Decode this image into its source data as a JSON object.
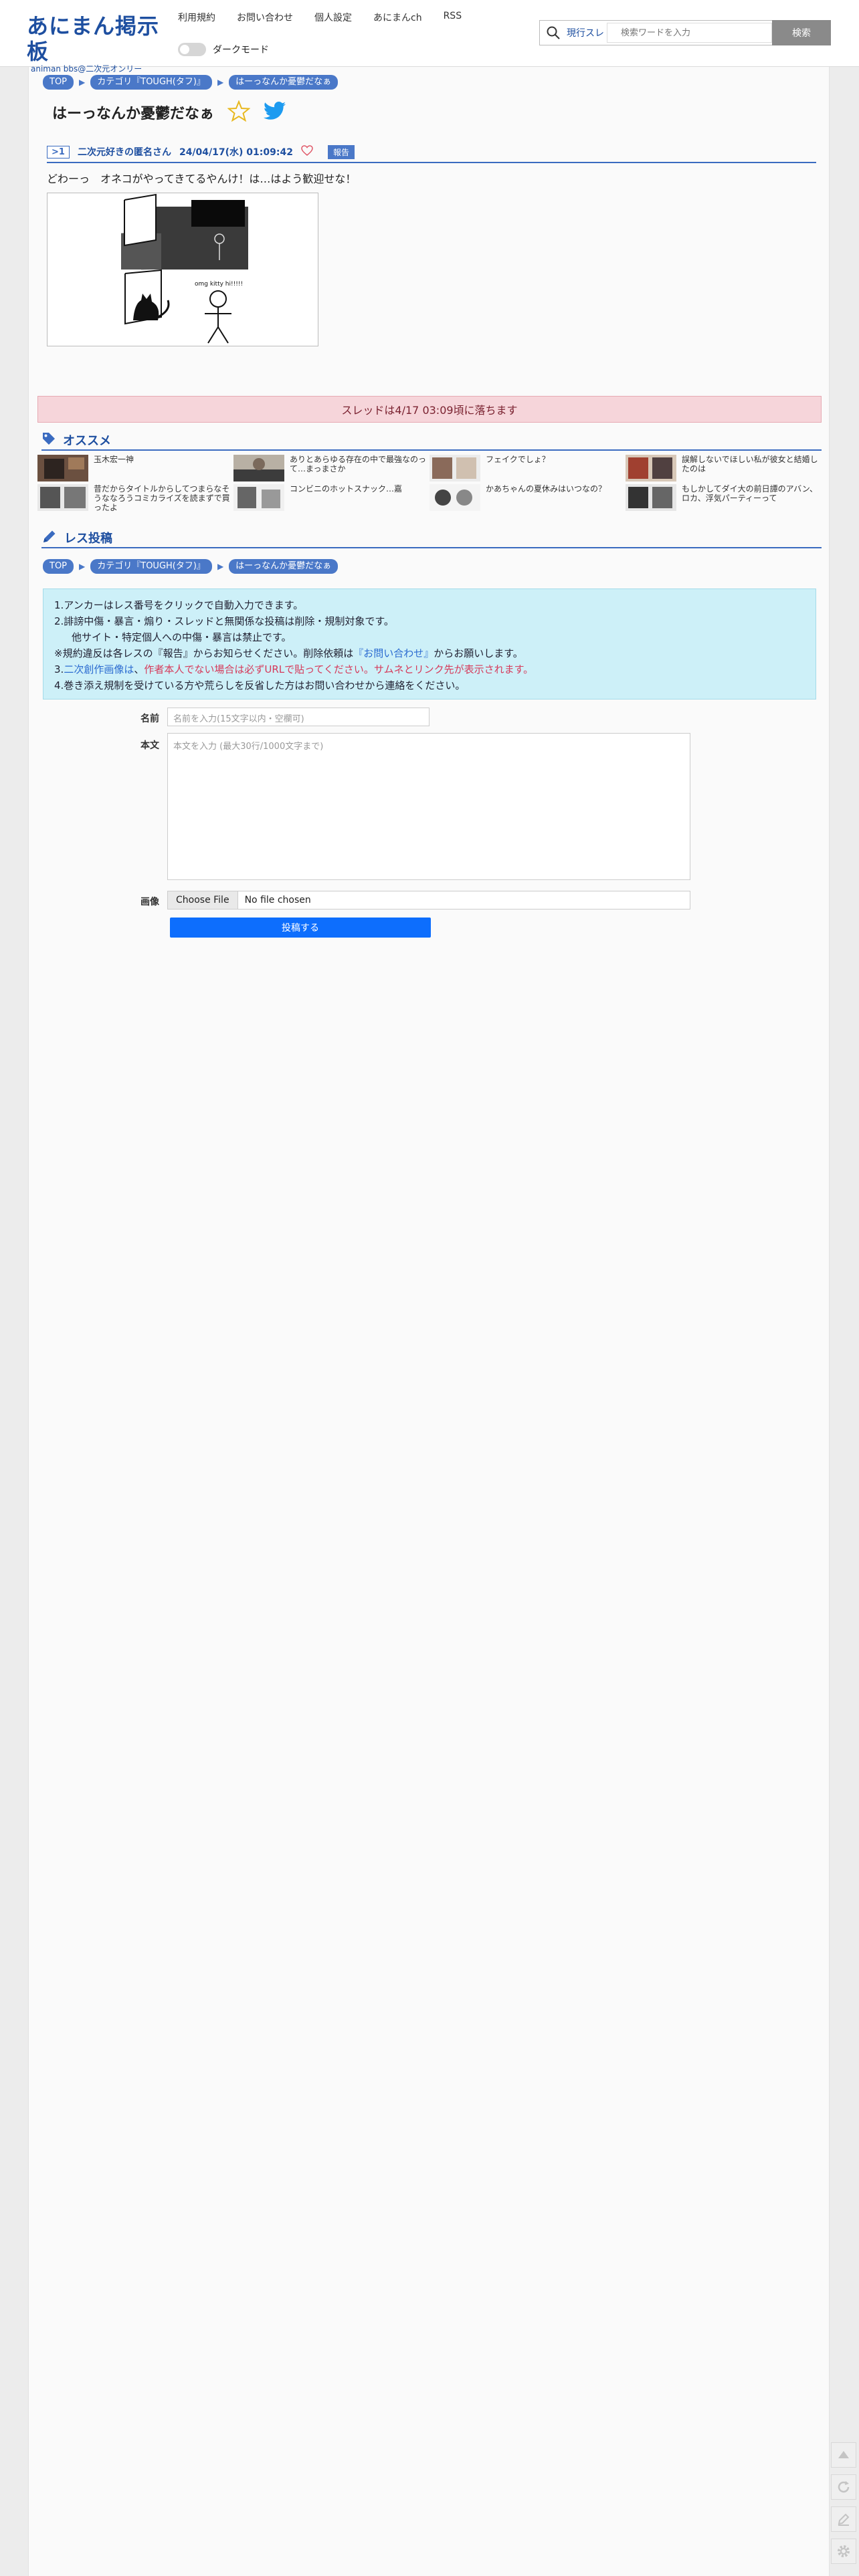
{
  "header": {
    "logo_main": "あにまん掲示板",
    "logo_sub": "animan bbs@二次元オンリー",
    "nav": [
      "利用規約",
      "お問い合わせ",
      "個人設定",
      "あにまんch",
      "RSS"
    ],
    "dark_mode_label": "ダークモード",
    "search_scope": "現行スレ",
    "search_placeholder": "検索ワードを入力",
    "search_button": "検索"
  },
  "breadcrumb": [
    "TOP",
    "カテゴリ『TOUGH(タフ)』",
    "はーっなんか憂鬱だなぁ"
  ],
  "thread": {
    "title": "はーっなんか憂鬱だなぁ"
  },
  "post": {
    "number": ">1",
    "name": "二次元好きの匿名さん",
    "date": "24/04/17(水) 01:09:42",
    "report_label": "報告",
    "body": "どわーっ　オネコがやってきてるやんけ！は…はよう歓迎せな！",
    "image_caption": "omg kitty hi!!!!!"
  },
  "fall_notice": "スレッドは4/17 03:09頃に落ちます",
  "recommend": {
    "heading": "オススメ",
    "columns": [
      [
        "玉木宏一神",
        "昔だからタイトルからしてつまらなそうななろうコミカライズを読まずで買ったよ"
      ],
      [
        "ありとあらゆる存在の中で最強なのって…まっまさか",
        "コンビニのホットスナック…嘉"
      ],
      [
        "フェイクでしょ？",
        "かあちゃんの夏休みはいつなの？"
      ],
      [
        "誤解しないでほしい私が彼女と結婚したのは",
        "もしかしてダイ大の前日譚のアバン、ロカ、浮気パーティーって"
      ]
    ]
  },
  "reply": {
    "heading": "レス投稿",
    "rules": {
      "line1": "1.アンカーはレス番号をクリックで自動入力できます。",
      "line2": "2.誹謗中傷・暴言・煽り・スレッドと無関係な投稿は削除・規制対象です。",
      "line2b": "他サイト・特定個人への中傷・暴言は禁止です。",
      "line3a": "※規約違反は各レスの『報告』からお知らせください。削除依頼は",
      "line3b": "『お問い合わせ』",
      "line3c": "からお願いします。",
      "line4a": "3.",
      "line4b": "二次創作画像は",
      "line4c": "、",
      "line4d": "作者本人でない場合は必ずURLで貼ってください。サムネとリンク先が表示されます。",
      "line5": "4.巻き添え規制を受けている方や荒らしを反省した方はお問い合わせから連絡をください。"
    },
    "name_label": "名前",
    "name_placeholder": "名前を入力(15文字以内・空欄可)",
    "body_label": "本文",
    "body_placeholder": "本文を入力 (最大30行/1000文字まで)",
    "image_label": "画像",
    "file_button": "Choose File",
    "file_status": "No file chosen",
    "submit": "投稿する"
  },
  "colors": {
    "accent": "#3a6bc0",
    "banner": "#f6d5da",
    "rules_bg": "#cdf0f8",
    "submit": "#0d6efd"
  }
}
